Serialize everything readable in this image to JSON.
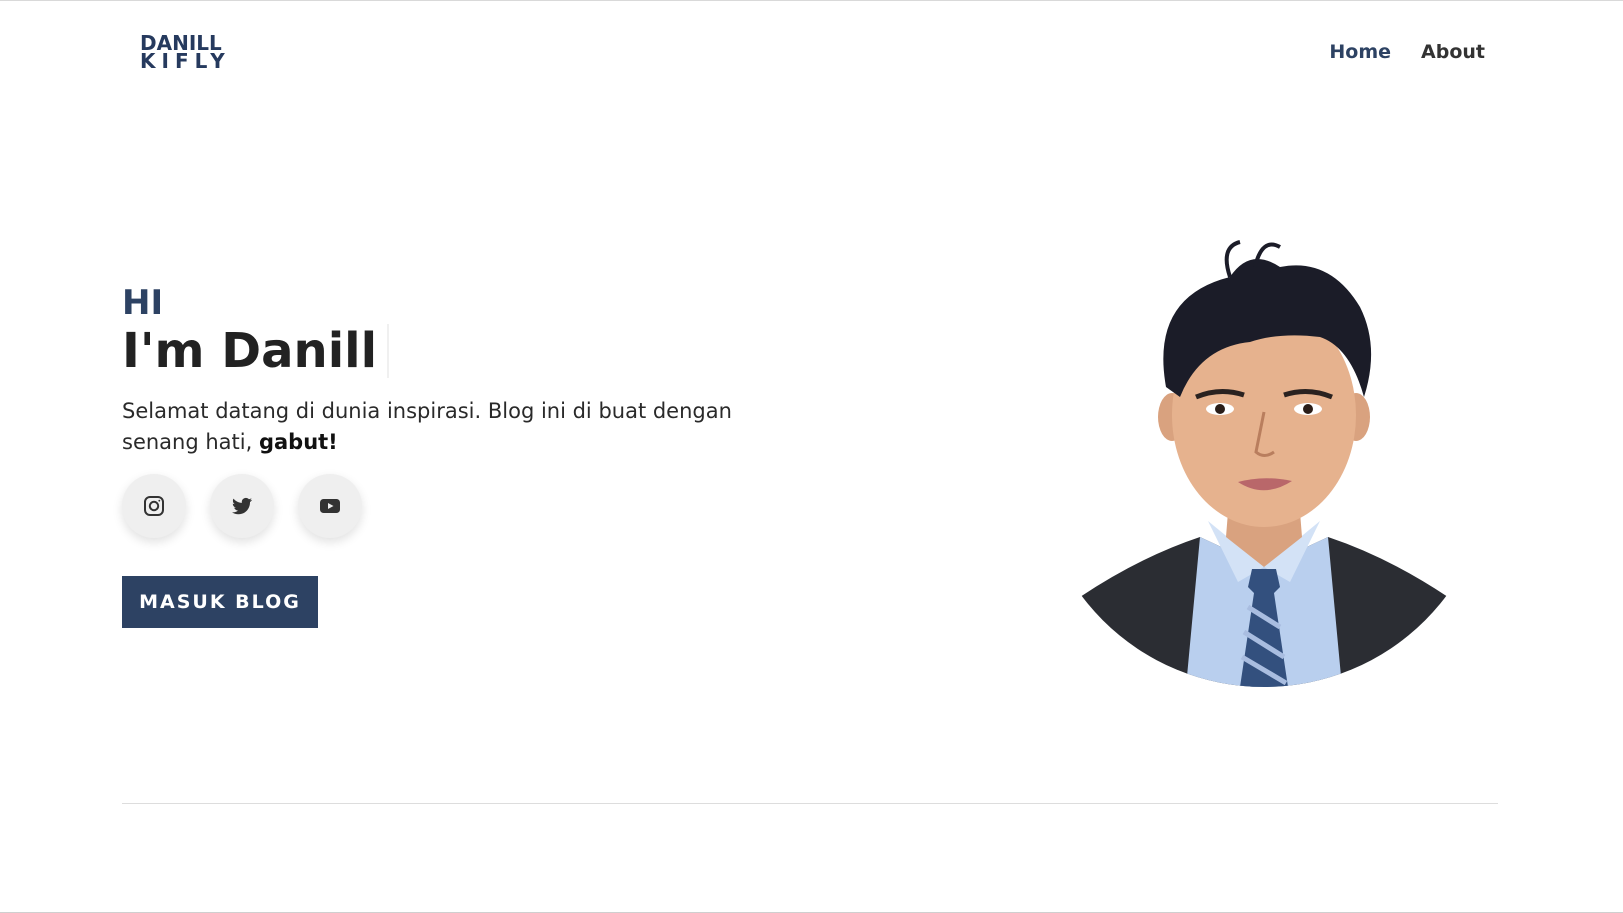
{
  "header": {
    "logo_line1": "DANILL",
    "logo_line2": "KIFLY",
    "nav": {
      "home": "Home",
      "about": "About"
    }
  },
  "hero": {
    "greeting": "HI",
    "headline": "I'm Danill",
    "intro_text": "Selamat datang di dunia inspirasi. Blog ini di buat dengan senang hati, ",
    "intro_bold": "gabut!",
    "socials": [
      "instagram-icon",
      "twitter-icon",
      "youtube-icon"
    ],
    "cta_label": "MASUK BLOG"
  },
  "colors": {
    "accent": "#2d4263",
    "text": "#222222",
    "social_bg": "#efefef"
  }
}
